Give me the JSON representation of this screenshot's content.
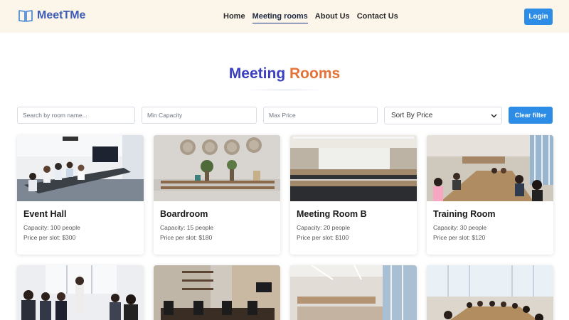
{
  "brand": {
    "name": "MeetTMe"
  },
  "nav": {
    "items": [
      "Home",
      "Meeting rooms",
      "About Us",
      "Contact Us"
    ],
    "active": "Meeting rooms"
  },
  "header": {
    "login_label": "Login"
  },
  "page": {
    "title_part1": "Meeting",
    "title_part2": "Rooms"
  },
  "filters": {
    "search_placeholder": "Search by room name...",
    "min_capacity_placeholder": "Min Capacity",
    "max_price_placeholder": "Max Price",
    "sort_selected": "Sort By Price",
    "clear_label": "Clear filter"
  },
  "rooms": [
    {
      "name": "Event Hall",
      "capacity": "Capacity: 100 people",
      "price": "Price per slot: $300"
    },
    {
      "name": "Boardroom",
      "capacity": "Capacity: 15 people",
      "price": "Price per slot: $180"
    },
    {
      "name": "Meeting Room B",
      "capacity": "Capacity: 20 people",
      "price": "Price per slot: $100"
    },
    {
      "name": "Training Room",
      "capacity": "Capacity: 30 people",
      "price": "Price per slot: $120"
    }
  ],
  "colors": {
    "accent": "#2d8de6",
    "brand": "#3b5bb5",
    "header_bg": "#fcf5ea",
    "title_blue": "#3a3fbf",
    "title_orange": "#e2743a"
  }
}
